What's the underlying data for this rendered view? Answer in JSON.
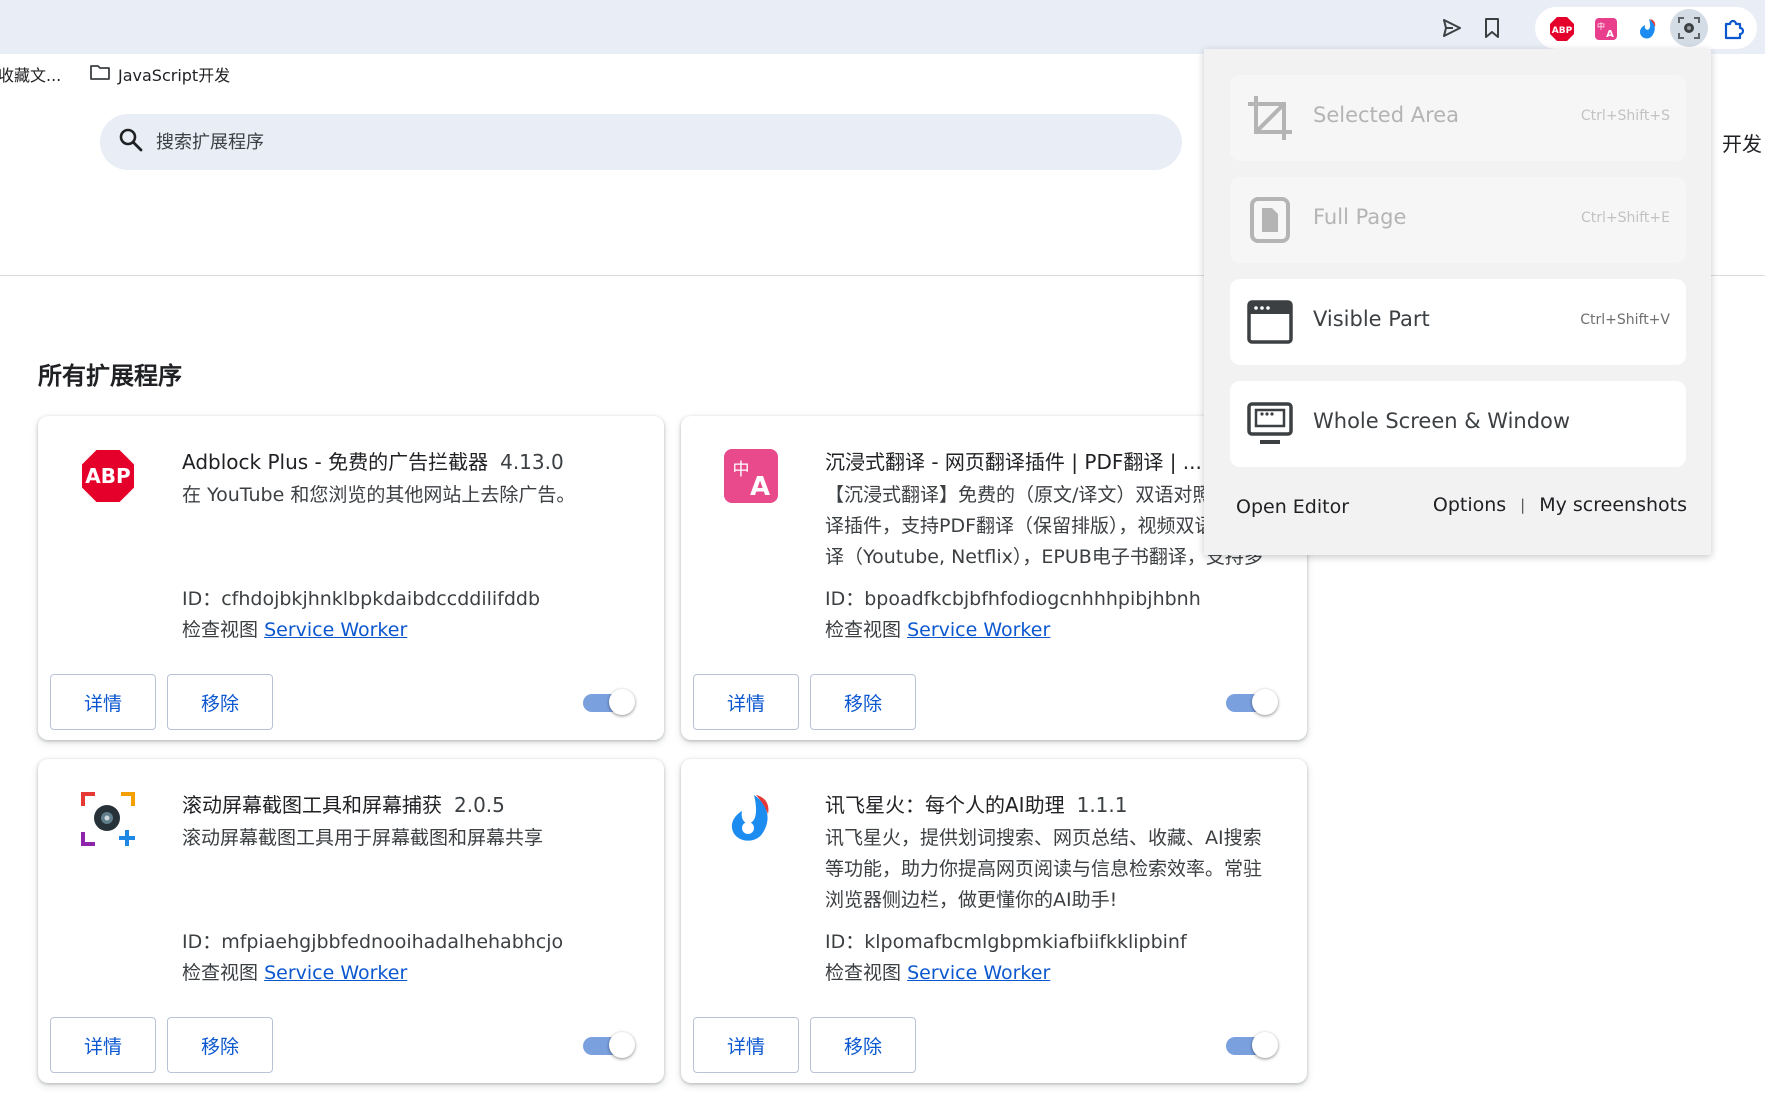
{
  "bookmarks": [
    {
      "label": "收藏文..."
    },
    {
      "label": "JavaScript开发"
    }
  ],
  "search": {
    "placeholder": "搜索扩展程序"
  },
  "header_right_label": "开发",
  "section_title": "所有扩展程序",
  "toolbar_icons": [
    "send-icon",
    "bookmark-icon",
    "abp-icon",
    "translate-icon",
    "spark-icon",
    "screenshot-icon",
    "puzzle-icon"
  ],
  "cards": [
    {
      "title": "Adblock Plus - 免费的广告拦截器",
      "version": "4.13.0",
      "description": "在 YouTube 和您浏览的其他网站上去除广告。",
      "id": "ID：cfhdojbkjhnklbpkdaibdccddilifddb",
      "views_label": "检查视图",
      "views_link": "Service Worker",
      "details_label": "详情",
      "remove_label": "移除",
      "enabled": true,
      "icon": "abp-logo-icon"
    },
    {
      "title": "沉浸式翻译 - 网页翻译插件 | PDF翻译 | ...",
      "version": "",
      "description": "【沉浸式翻译】免费的（原文/译文）双语对照网页翻译插件，支持PDF翻译（保留排版），视频双语字幕翻译（Youtube, Netflix），EPUB电子书翻译，支持多种翻译服务",
      "id": "ID：bpoadfkcbjbfhfodiogcnhhhpibjhbnh",
      "views_label": "检查视图",
      "views_link": "Service Worker",
      "details_label": "详情",
      "remove_label": "移除",
      "enabled": true,
      "icon": "translate-logo-icon"
    },
    {
      "title": "滚动屏幕截图工具和屏幕捕获",
      "version": "2.0.5",
      "description": "滚动屏幕截图工具用于屏幕截图和屏幕共享",
      "id": "ID：mfpiaehgjbbfednooihadalhehabhcjo",
      "views_label": "检查视图",
      "views_link": "Service Worker",
      "details_label": "详情",
      "remove_label": "移除",
      "enabled": true,
      "icon": "screenshot-logo-icon"
    },
    {
      "title": "讯飞星火：每个人的AI助理",
      "version": "1.1.1",
      "description": "讯飞星火，提供划词搜索、网页总结、收藏、AI搜索等功能，助力你提高网页阅读与信息检索效率。常驻浏览器侧边栏，做更懂你的AI助手!",
      "id": "ID：klpomafbcmlgbpmkiafbiifkklipbinf",
      "views_label": "检查视图",
      "views_link": "Service Worker",
      "details_label": "详情",
      "remove_label": "移除",
      "enabled": true,
      "icon": "spark-logo-icon"
    }
  ],
  "popup": {
    "items": [
      {
        "label": "Selected Area",
        "shortcut": "Ctrl+Shift+S",
        "enabled": false,
        "icon": "crop-icon"
      },
      {
        "label": "Full Page",
        "shortcut": "Ctrl+Shift+E",
        "enabled": false,
        "icon": "page-icon"
      },
      {
        "label": "Visible Part",
        "shortcut": "Ctrl+Shift+V",
        "enabled": true,
        "icon": "browser-window-icon"
      },
      {
        "label": "Whole Screen & Window",
        "shortcut": "",
        "enabled": true,
        "icon": "monitor-icon"
      }
    ],
    "open_editor": "Open Editor",
    "options": "Options",
    "separator": "|",
    "my_screenshots": "My screenshots"
  },
  "colors": {
    "accent": "#0b57d0",
    "toggle_track": "#7aa0de",
    "topbar": "#e9eef6",
    "search_bg": "#e8edf6"
  }
}
